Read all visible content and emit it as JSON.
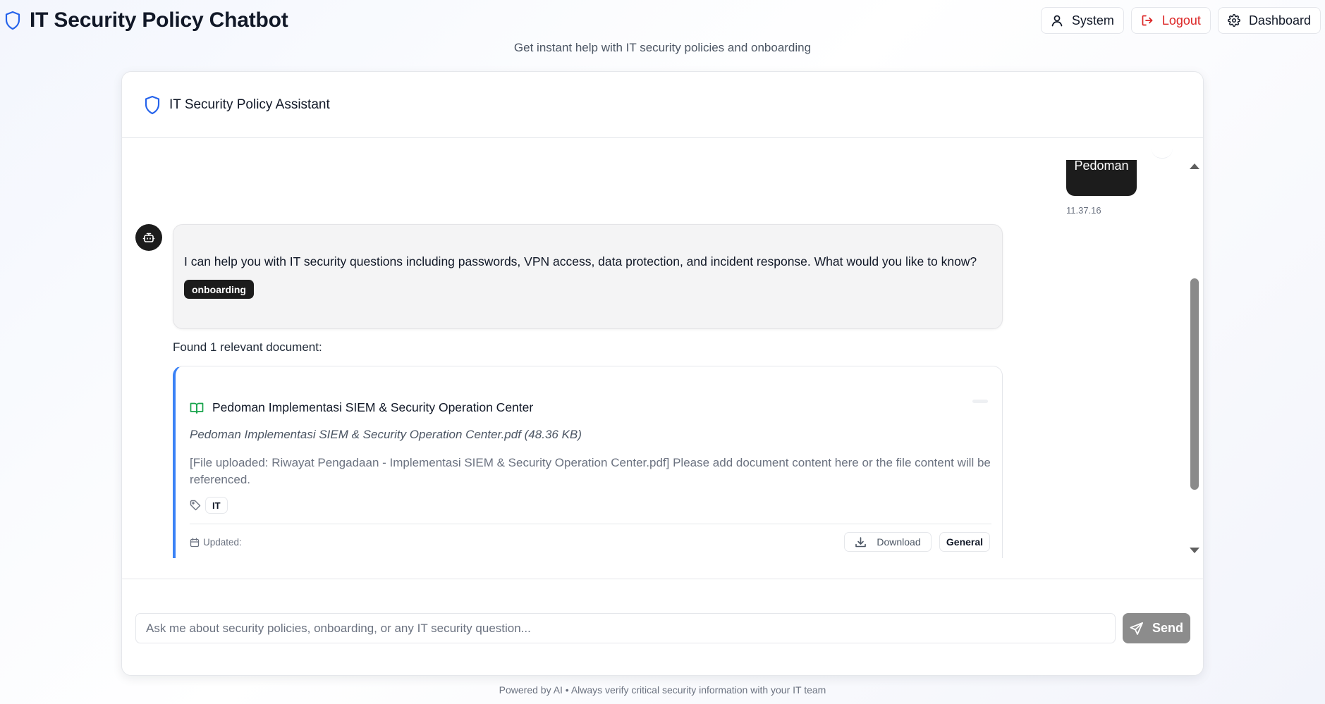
{
  "header": {
    "title": "IT Security Policy Chatbot",
    "subtitle": "Get instant help with IT security policies and onboarding",
    "nav": {
      "system_label": "System",
      "logout_label": "Logout",
      "dashboard_label": "Dashboard"
    }
  },
  "chat": {
    "title": "IT Security Policy Assistant",
    "user_message": {
      "text": "Pedoman",
      "time": "11.37.16"
    },
    "bot_message": {
      "text": "I can help you with IT security questions including passwords, VPN access, data protection, and incident response. What would you like to know?",
      "tag": "onboarding"
    },
    "found_label": "Found 1 relevant document:",
    "document": {
      "title": "Pedoman Implementasi SIEM & Security Operation Center",
      "file": "Pedoman Implementasi SIEM & Security Operation Center.pdf (48.36 KB)",
      "description": "[File uploaded: Riwayat Pengadaan - Implementasi SIEM & Security Operation Center.pdf] Please add document content here or the file content will be referenced.",
      "tag": "IT",
      "updated_label": "Updated:",
      "download_label": "Download",
      "category": "General"
    },
    "input_placeholder": "Ask me about security policies, onboarding, or any IT security question...",
    "send_label": "Send"
  },
  "footer": {
    "text": "Powered by AI • Always verify critical security information with your IT team"
  },
  "colors": {
    "accent_blue": "#2563eb",
    "logout_red": "#dc2626",
    "doc_border_blue": "#3b82f6",
    "book_green": "#16a34a",
    "dark_bubble": "#1c1c1c",
    "send_button": "#8c8c8c"
  },
  "icons": {
    "brand": "shield-icon",
    "system": "user-icon",
    "logout": "logout-icon",
    "dashboard": "gear-icon",
    "bot": "bot-icon",
    "document": "book-open-icon",
    "tag": "tag-icon",
    "updated": "calendar-icon",
    "download": "download-icon",
    "send": "send-icon"
  }
}
